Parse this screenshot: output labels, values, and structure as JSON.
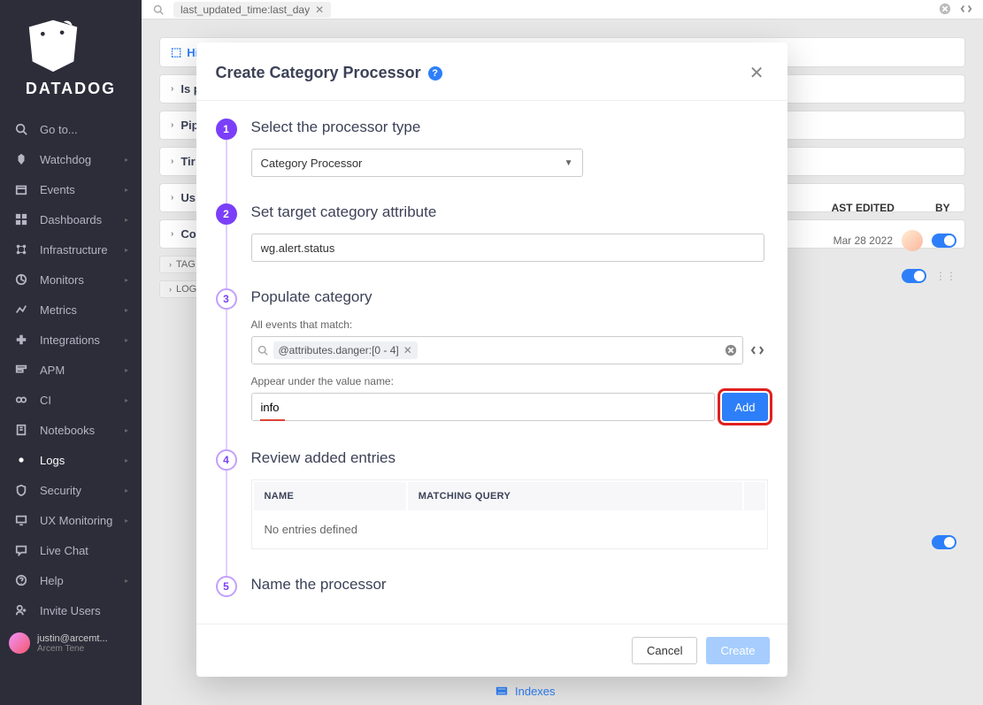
{
  "brand": {
    "name": "DATADOG"
  },
  "sidebar": {
    "items": [
      {
        "label": "Go to...",
        "icon": "search"
      },
      {
        "label": "Watchdog",
        "icon": "watchdog"
      },
      {
        "label": "Events",
        "icon": "events"
      },
      {
        "label": "Dashboards",
        "icon": "dashboards"
      },
      {
        "label": "Infrastructure",
        "icon": "infrastructure"
      },
      {
        "label": "Monitors",
        "icon": "monitors"
      },
      {
        "label": "Metrics",
        "icon": "metrics"
      },
      {
        "label": "Integrations",
        "icon": "integrations"
      },
      {
        "label": "APM",
        "icon": "apm"
      },
      {
        "label": "CI",
        "icon": "ci"
      },
      {
        "label": "Notebooks",
        "icon": "notebooks"
      },
      {
        "label": "Logs",
        "icon": "logs",
        "active": true
      },
      {
        "label": "Security",
        "icon": "security"
      },
      {
        "label": "UX Monitoring",
        "icon": "ux"
      }
    ],
    "bottom": [
      {
        "label": "Live Chat",
        "icon": "chat"
      },
      {
        "label": "Help",
        "icon": "help"
      },
      {
        "label": "Invite Users",
        "icon": "invite"
      }
    ],
    "user": {
      "email": "justin@arcemt...",
      "org": "Arcem Tene"
    }
  },
  "topbar": {
    "search_pill": "last_updated_time:last_day"
  },
  "background": {
    "crumb_link": "Hi",
    "rows": [
      "Is p",
      "Pip",
      "Tir",
      "Us",
      "Co"
    ],
    "tags": [
      "TAG",
      "LOG"
    ],
    "table": {
      "th_last_edited": "AST EDITED",
      "th_by": "BY",
      "date": "Mar 28 2022"
    },
    "indexes_label": "Indexes"
  },
  "modal": {
    "title": "Create Category Processor",
    "steps": {
      "s1": {
        "num": "1",
        "title": "Select the processor type",
        "select_value": "Category Processor"
      },
      "s2": {
        "num": "2",
        "title": "Set target category attribute",
        "input_value": "wg.alert.status"
      },
      "s3": {
        "num": "3",
        "title": "Populate category",
        "match_label": "All events that match:",
        "query_pill": "@attributes.danger:[0 - 4]",
        "value_label": "Appear under the value name:",
        "value_input": "info",
        "add_label": "Add"
      },
      "s4": {
        "num": "4",
        "title": "Review added entries",
        "th_name": "NAME",
        "th_query": "MATCHING QUERY",
        "empty": "No entries defined"
      },
      "s5": {
        "num": "5",
        "title": "Name the processor"
      }
    },
    "footer": {
      "cancel": "Cancel",
      "create": "Create"
    }
  }
}
